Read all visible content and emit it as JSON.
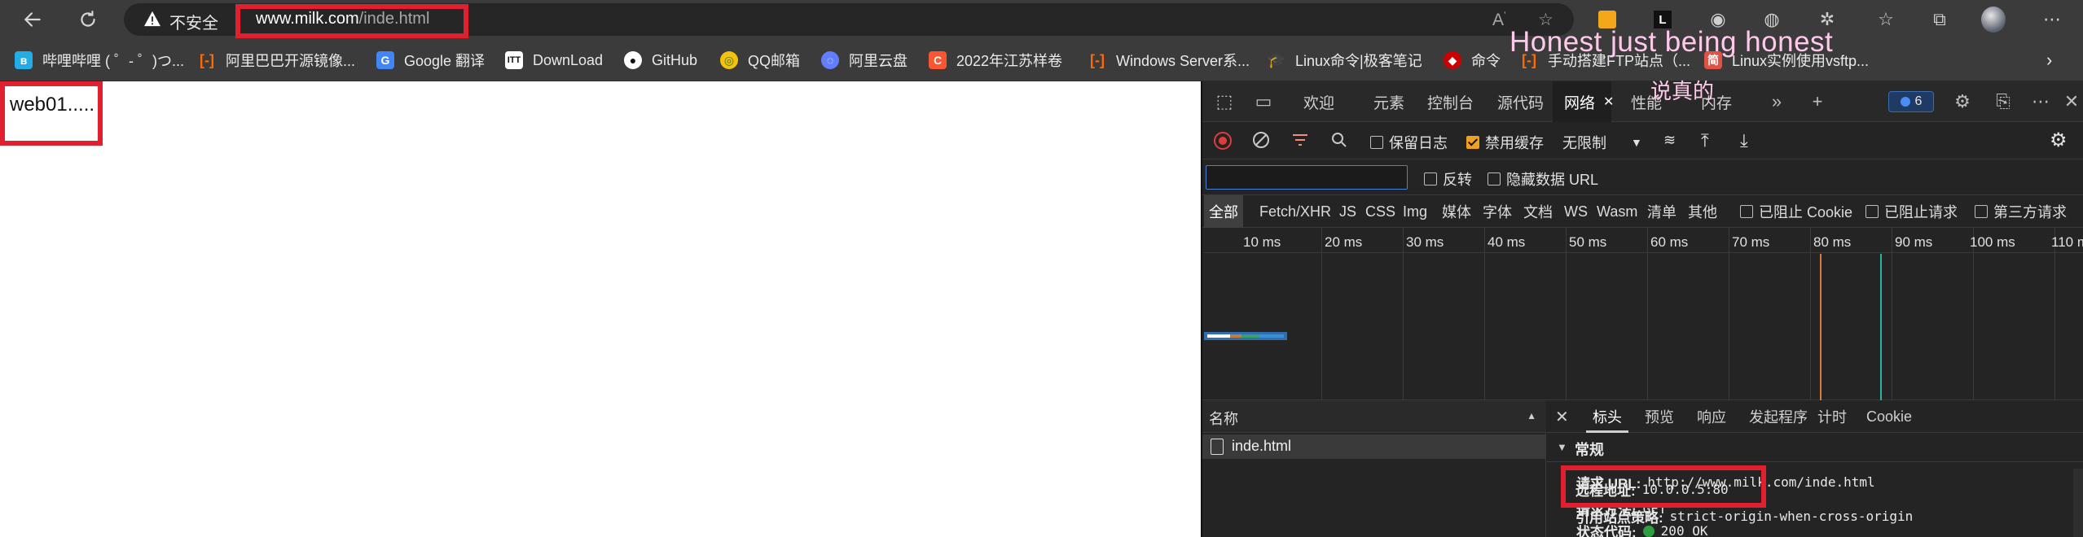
{
  "browser": {
    "security_label": "不安全",
    "url_host": "www.milk.com",
    "url_path": "/inde.html",
    "extension_count": "6"
  },
  "bookmarks": [
    {
      "label": "哔哩哔哩 ( ゜- ゜)つ...",
      "icon": "bilibili-icon",
      "color": "#23ade5"
    },
    {
      "label": "阿里巴巴开源镜像...",
      "icon": "aliyun-icon",
      "color": "#ff6a00"
    },
    {
      "label": "Google 翻译",
      "icon": "google-translate-icon",
      "color": "#4285f4"
    },
    {
      "label": "DownLoad",
      "icon": "download-site-icon",
      "color": "#ffffff"
    },
    {
      "label": "GitHub",
      "icon": "github-icon",
      "color": "#ffffff"
    },
    {
      "label": "QQ邮箱",
      "icon": "qq-mail-icon",
      "color": "#f4c20d"
    },
    {
      "label": "阿里云盘",
      "icon": "aliyun-drive-icon",
      "color": "#637dff"
    },
    {
      "label": "2022年江苏样卷",
      "icon": "csdn-icon",
      "color": "#fc5531"
    },
    {
      "label": "Windows Server系...",
      "icon": "aliyun-icon",
      "color": "#ff6a00"
    },
    {
      "label": "Linux命令|极客笔记",
      "icon": "hat-icon",
      "color": "#222222"
    },
    {
      "label": "命令",
      "icon": "redhat-icon",
      "color": "#cc0000"
    },
    {
      "label": "手动搭建FTP站点（...",
      "icon": "aliyun-icon",
      "color": "#ff6a00"
    },
    {
      "label": "Linux实例使用vsftp...",
      "icon": "jian-icon",
      "color": "#e05244"
    }
  ],
  "watermark": {
    "line1": "Honest  just being honest",
    "line2": "说真的"
  },
  "page": {
    "content": "web01....."
  },
  "devtools": {
    "tabs": [
      "欢迎",
      "元素",
      "控制台",
      "源代码",
      "网络",
      "性能",
      "内存"
    ],
    "active_tab": "网络",
    "toolbar": {
      "preserve_log": "保留日志",
      "disable_cache": "禁用缓存",
      "throttle": "无限制"
    },
    "filter": {
      "placeholder": "",
      "invert": "反转",
      "hide_data_urls": "隐藏数据 URL"
    },
    "types": [
      "全部",
      "Fetch/XHR",
      "JS",
      "CSS",
      "Img",
      "媒体",
      "字体",
      "文档",
      "WS",
      "Wasm",
      "清单",
      "其他"
    ],
    "type_checks": [
      "已阻止 Cookie",
      "已阻止请求",
      "第三方请求"
    ],
    "timeline_ticks": [
      "10 ms",
      "20 ms",
      "30 ms",
      "40 ms",
      "50 ms",
      "60 ms",
      "70 ms",
      "80 ms",
      "90 ms",
      "100 ms",
      "110 m"
    ],
    "requests_header": "名称",
    "requests": [
      {
        "name": "inde.html"
      }
    ],
    "detail_tabs": [
      "标头",
      "预览",
      "响应",
      "发起程序",
      "计时",
      "Cookie"
    ],
    "general": {
      "section_title": "常规",
      "rows": [
        {
          "key": "请求 URL:",
          "value": "http://www.milk.com/inde.html"
        },
        {
          "key": "请求方法:",
          "value": "GET"
        },
        {
          "key": "状态代码:",
          "value": "200 OK"
        },
        {
          "key": "远程地址:",
          "value": "10.0.0.5:80"
        },
        {
          "key": "引用站点策略:",
          "value": "strict-origin-when-cross-origin"
        }
      ]
    }
  }
}
